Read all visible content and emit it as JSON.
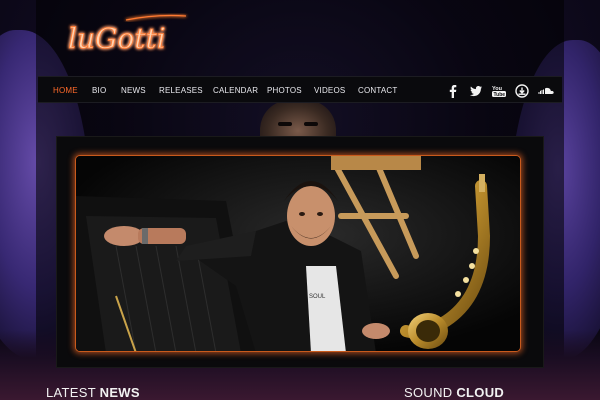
{
  "brand": {
    "logo_text": "luGotti",
    "accent_color": "#ff6a2a",
    "neon_color": "#ff8a3c"
  },
  "nav": {
    "items": [
      {
        "label": "HOME",
        "active": true
      },
      {
        "label": "BIO",
        "active": false
      },
      {
        "label": "NEWS",
        "active": false
      },
      {
        "label": "RELEASES",
        "active": false
      },
      {
        "label": "CALENDAR",
        "active": false
      },
      {
        "label": "PHOTOS",
        "active": false
      },
      {
        "label": "VIDEOS",
        "active": false
      },
      {
        "label": "CONTACT",
        "active": false
      }
    ]
  },
  "social": {
    "icons": [
      "facebook-icon",
      "twitter-icon",
      "youtube-icon",
      "music-download-icon",
      "soundcloud-icon"
    ]
  },
  "sections": {
    "latest_news": {
      "thin": "LATEST ",
      "bold": "NEWS"
    },
    "sound_cloud": {
      "thin": "SOUND ",
      "bold": "CLOUD"
    }
  }
}
